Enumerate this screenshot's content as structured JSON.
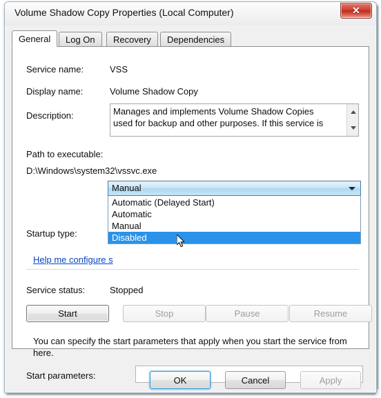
{
  "window": {
    "title": "Volume Shadow Copy Properties (Local Computer)",
    "close_label": "✕",
    "close_icon_name": "close-icon"
  },
  "tabs": [
    {
      "label": "General",
      "active": true
    },
    {
      "label": "Log On",
      "active": false
    },
    {
      "label": "Recovery",
      "active": false
    },
    {
      "label": "Dependencies",
      "active": false
    }
  ],
  "general": {
    "service_name_label": "Service name:",
    "service_name_value": "VSS",
    "display_name_label": "Display name:",
    "display_name_value": "Volume Shadow Copy",
    "description_label": "Description:",
    "description_value": "Manages and implements Volume Shadow Copies used for backup and other purposes. If this service is",
    "path_label": "Path to executable:",
    "path_value": "D:\\Windows\\system32\\vssvc.exe",
    "startup_type_label": "Startup type:",
    "startup_type_value": "Manual",
    "help_link": "Help me configure s",
    "service_status_label": "Service status:",
    "service_status_value": "Stopped"
  },
  "startup_options": [
    {
      "label": "Automatic (Delayed Start)",
      "selected": false
    },
    {
      "label": "Automatic",
      "selected": false
    },
    {
      "label": "Manual",
      "selected": false
    },
    {
      "label": "Disabled",
      "selected": true
    }
  ],
  "control_buttons": [
    {
      "label": "Start",
      "enabled": true,
      "focused": true
    },
    {
      "label": "Stop",
      "enabled": false,
      "focused": false
    },
    {
      "label": "Pause",
      "enabled": false,
      "focused": false
    },
    {
      "label": "Resume",
      "enabled": false,
      "focused": false
    }
  ],
  "start_parameters": {
    "info": "You can specify the start parameters that apply when you start the service from here.",
    "label": "Start parameters:",
    "value": ""
  },
  "dialog_buttons": [
    {
      "label": "OK",
      "enabled": true,
      "default": true
    },
    {
      "label": "Cancel",
      "enabled": true,
      "default": false
    },
    {
      "label": "Apply",
      "enabled": false,
      "default": false
    }
  ],
  "colors": {
    "close_red": "#bf2e1e",
    "selection_blue": "#2a92e8",
    "link_blue": "#0645c4",
    "combo_border": "#4b7ba3",
    "default_button_glow": "#2c9bd6"
  }
}
